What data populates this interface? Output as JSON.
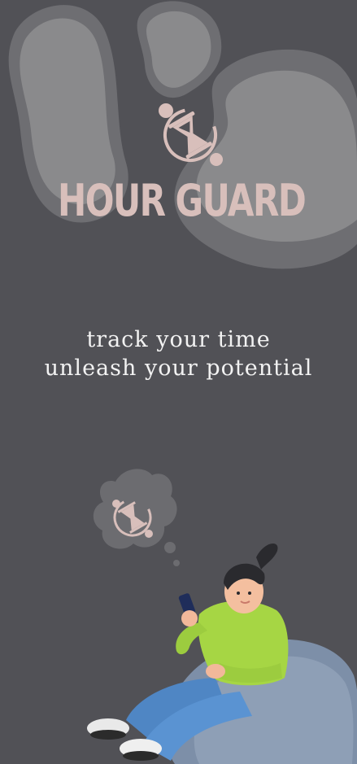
{
  "app": {
    "title": "HOUR GUARD"
  },
  "tagline": {
    "line1": "track your time",
    "line2": "unleash your potential"
  },
  "icons": {
    "logo": "hourglass-orbit-icon",
    "thought_bubble": "hourglass-thought-bubble-icon"
  },
  "colors": {
    "background": "#515156",
    "blob_light": "#8a8a8c",
    "blob_mid": "#6e6e72",
    "brand_pink": "#d8bfbb",
    "tagline_text": "#f2f2f2",
    "bubble": "#6c6c70"
  }
}
